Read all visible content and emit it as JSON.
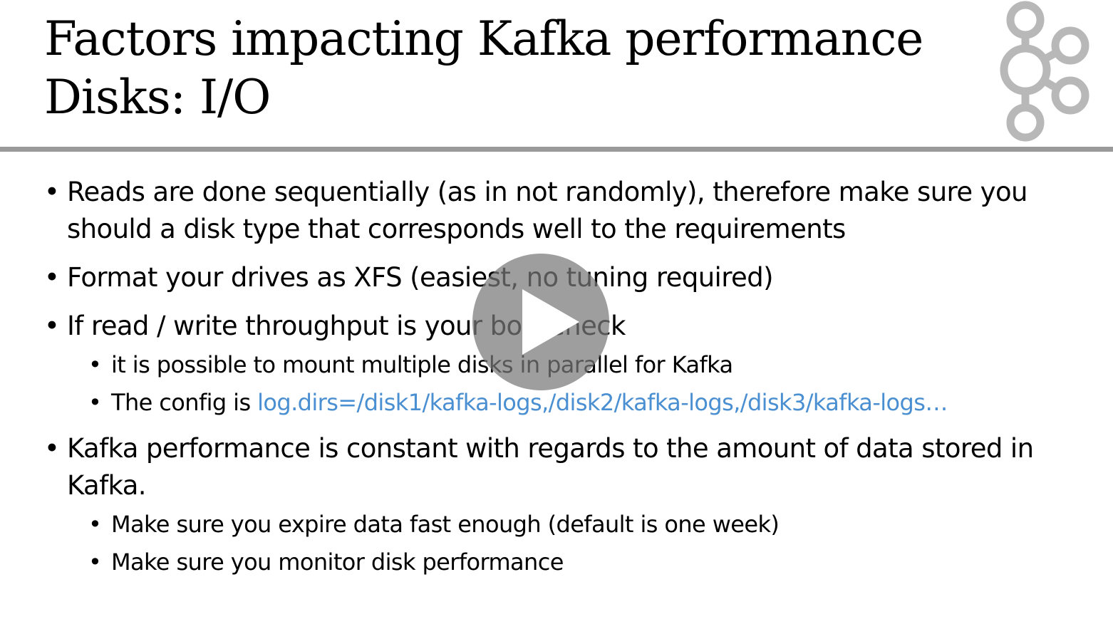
{
  "slide": {
    "title_line1": "Factors impacting Kafka performance",
    "title_line2": "Disks: I/O",
    "logo_icon": "kafka-logo-icon",
    "bullets": [
      {
        "text": "Reads are done sequentially (as in not randomly), therefore make sure you should a disk type that corresponds well to the requirements"
      },
      {
        "text": "Format your drives as XFS (easiest, no tuning required)"
      },
      {
        "text": "If read / write throughput is your bottleneck",
        "subs": [
          "it is possible to mount multiple disks in parallel for Kafka",
          "The config is"
        ],
        "config_value": "log.dirs=/disk1/kafka-logs,/disk2/kafka-logs,/disk3/kafka-logs…"
      },
      {
        "text": "Kafka performance is constant with regards to the amount of data stored in Kafka.",
        "subs": [
          "Make sure you expire data fast enough (default is one week)",
          "Make sure you monitor disk performance"
        ]
      }
    ]
  },
  "player": {
    "play_icon": "play-icon"
  },
  "colors": {
    "link": "#4a8fd1",
    "divider": "#9a9a9a",
    "logo": "#b8b8b8"
  }
}
